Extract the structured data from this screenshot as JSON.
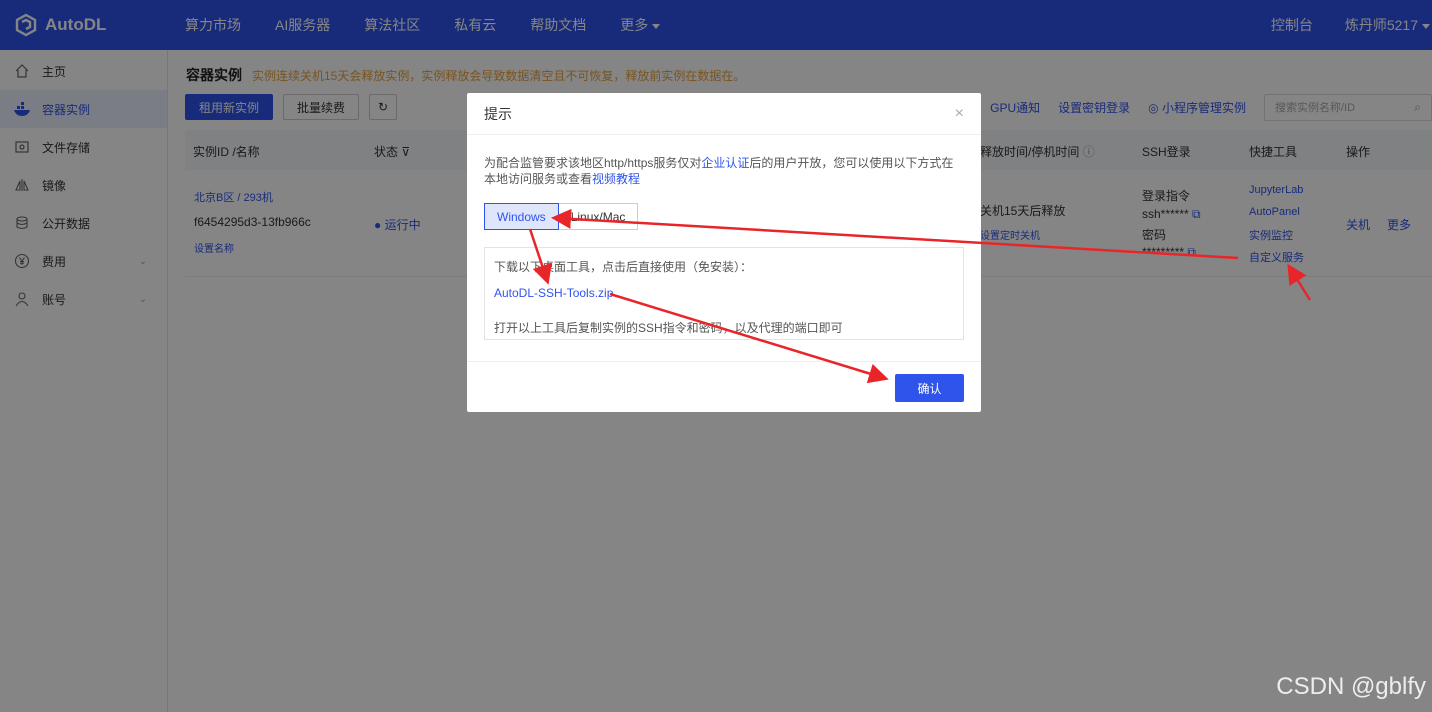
{
  "app": {
    "brand": "AutoDL"
  },
  "nav": {
    "items": [
      "算力市场",
      "AI服务器",
      "算法社区",
      "私有云",
      "帮助文档",
      "更多"
    ],
    "console": "控制台",
    "user": "炼丹师5217"
  },
  "sidebar": {
    "items": [
      {
        "label": "主页",
        "icon": "home-icon"
      },
      {
        "label": "容器实例",
        "icon": "container-icon"
      },
      {
        "label": "文件存储",
        "icon": "storage-icon"
      },
      {
        "label": "镜像",
        "icon": "image-icon"
      },
      {
        "label": "公开数据",
        "icon": "database-icon"
      },
      {
        "label": "费用",
        "icon": "yen-icon"
      },
      {
        "label": "账号",
        "icon": "user-icon"
      }
    ]
  },
  "page": {
    "title": "容器实例",
    "notice": "实例连续关机15天会释放实例，实例释放会导致数据清空且不可恢复，释放前实例在数据在。",
    "rent_button": "租用新实例",
    "renew_button": "批量续费",
    "links": {
      "gpu_notify": "GPU通知",
      "ssh_key": "设置密钥登录",
      "mini_program": "小程序管理实例"
    },
    "search_placeholder": "搜索实例名称/ID"
  },
  "table": {
    "headers": {
      "id_name": "实例ID /名称",
      "status": "状态",
      "release": "释放时间/停机时间",
      "ssh": "SSH登录",
      "tools": "快捷工具",
      "ops": "操作"
    },
    "row": {
      "region": "北京B区 / 293机",
      "id": "f6454295d3-13fb966c",
      "set_name": "设置名称",
      "status": "运行中",
      "release_text": "关机15天后释放",
      "release_link": "设置定时关机",
      "ssh_cmd_label": "登录指令",
      "ssh_cmd": "ssh******",
      "pwd_label": "密码",
      "pwd": "*********",
      "tools": [
        "JupyterLab",
        "AutoPanel",
        "实例监控",
        "自定义服务"
      ],
      "op_shutdown": "关机",
      "op_more": "更多"
    }
  },
  "modal": {
    "title": "提示",
    "desc_1": "为配合监管要求该地区http/https服务仅对",
    "desc_link_1": "企业认证",
    "desc_2": "后的用户开放，您可以使用以下方式在本地访问服务或查看",
    "desc_link_2": "视频教程",
    "tab_windows": "Windows",
    "tab_linux": "Linux/Mac",
    "panel_line_1": "下载以下桌面工具，点击后直接使用（免安装）：",
    "panel_link": "AutoDL-SSH-Tools.zip",
    "panel_line_2": "打开以上工具后复制实例的SSH指令和密码，以及代理的端口即可",
    "ok_button": "确认"
  },
  "watermark": "CSDN @gblfy",
  "colors": {
    "primary": "#2f54eb",
    "warning": "#e6a23c",
    "arrow": "#e8262a"
  }
}
